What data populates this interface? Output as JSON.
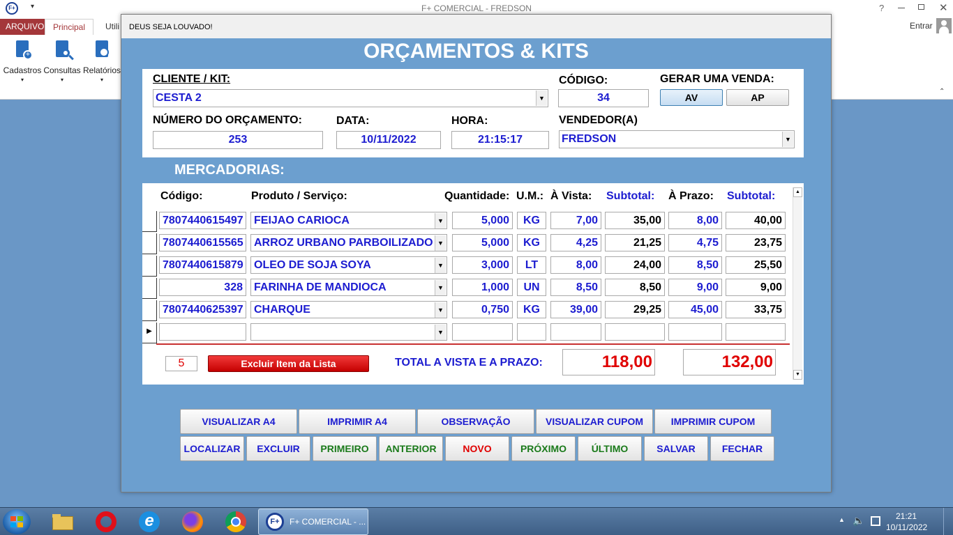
{
  "app": {
    "title": "F+ COMERCIAL - FREDSON",
    "help": "?",
    "signin": "Entrar"
  },
  "ribbon": {
    "tabs": [
      "ARQUIVO",
      "Principal",
      "Utili"
    ],
    "buttons": [
      "Cadastros",
      "Consultas",
      "Relatórios"
    ]
  },
  "form": {
    "caption": "DEUS SEJA LOUVADO!",
    "title": "ORÇAMENTOS & KITS",
    "labels": {
      "cliente": "CLIENTE / KIT:",
      "codigo": "CÓDIGO:",
      "gerar": "GERAR UMA VENDA:",
      "numero": "NÚMERO DO ORÇAMENTO:",
      "data": "DATA:",
      "hora": "HORA:",
      "vendedor": "VENDEDOR(A)",
      "mercadorias": "MERCADORIAS:"
    },
    "values": {
      "cliente": "CESTA 2",
      "codigo": "34",
      "numero": "253",
      "data": "10/11/2022",
      "hora": "21:15:17",
      "vendedor": "FREDSON"
    },
    "venda_buttons": [
      "AV",
      "AP"
    ]
  },
  "grid": {
    "headers": [
      "Código:",
      "Produto / Serviço:",
      "Quantidade:",
      "U.M.:",
      "À Vista:",
      "Subtotal:",
      "À Prazo:",
      "Subtotal:"
    ],
    "rows": [
      {
        "codigo": "7807440615497",
        "produto": "FEIJAO CARIOCA",
        "qtd": "5,000",
        "um": "KG",
        "vista": "7,00",
        "sub1": "35,00",
        "prazo": "8,00",
        "sub2": "40,00"
      },
      {
        "codigo": "7807440615565",
        "produto": "ARROZ URBANO PARBOILIZADO",
        "qtd": "5,000",
        "um": "KG",
        "vista": "4,25",
        "sub1": "21,25",
        "prazo": "4,75",
        "sub2": "23,75"
      },
      {
        "codigo": "7807440615879",
        "produto": "OLEO DE SOJA SOYA",
        "qtd": "3,000",
        "um": "LT",
        "vista": "8,00",
        "sub1": "24,00",
        "prazo": "8,50",
        "sub2": "25,50"
      },
      {
        "codigo": "328",
        "produto": "FARINHA DE MANDIOCA",
        "qtd": "1,000",
        "um": "UN",
        "vista": "8,50",
        "sub1": "8,50",
        "prazo": "9,00",
        "sub2": "9,00"
      },
      {
        "codigo": "7807440625397",
        "produto": "CHARQUE",
        "qtd": "0,750",
        "um": "KG",
        "vista": "39,00",
        "sub1": "29,25",
        "prazo": "45,00",
        "sub2": "33,75"
      },
      {
        "codigo": "",
        "produto": "",
        "qtd": "",
        "um": "",
        "vista": "",
        "sub1": "",
        "prazo": "",
        "sub2": ""
      }
    ],
    "item_count": "5",
    "excluir_label": "Excluir Item da Lista",
    "total_label": "TOTAL A VISTA E A PRAZO:",
    "total_vista": "118,00",
    "total_prazo": "132,00"
  },
  "actions_row1": [
    "VISUALIZAR A4",
    "IMPRIMIR A4",
    "OBSERVAÇÃO",
    "VISUALIZAR CUPOM",
    "IMPRIMIR CUPOM"
  ],
  "actions_row2": [
    "LOCALIZAR",
    "EXCLUIR",
    "PRIMEIRO",
    "ANTERIOR",
    "NOVO",
    "PRÓXIMO",
    "ÚLTIMO",
    "SALVAR",
    "FECHAR"
  ],
  "colors": {
    "nav_green": "#1a7a1a",
    "nav_red": "#e00000",
    "label_blue": "#1c1cd0",
    "excluir_red": "#e00000"
  },
  "taskbar": {
    "task_label": "F+ COMERCIAL - ...",
    "time": "21:21",
    "date": "10/11/2022",
    "icons": [
      "windows-start-icon",
      "file-explorer-icon",
      "opera-icon",
      "internet-explorer-icon",
      "firefox-icon",
      "chrome-icon"
    ]
  }
}
